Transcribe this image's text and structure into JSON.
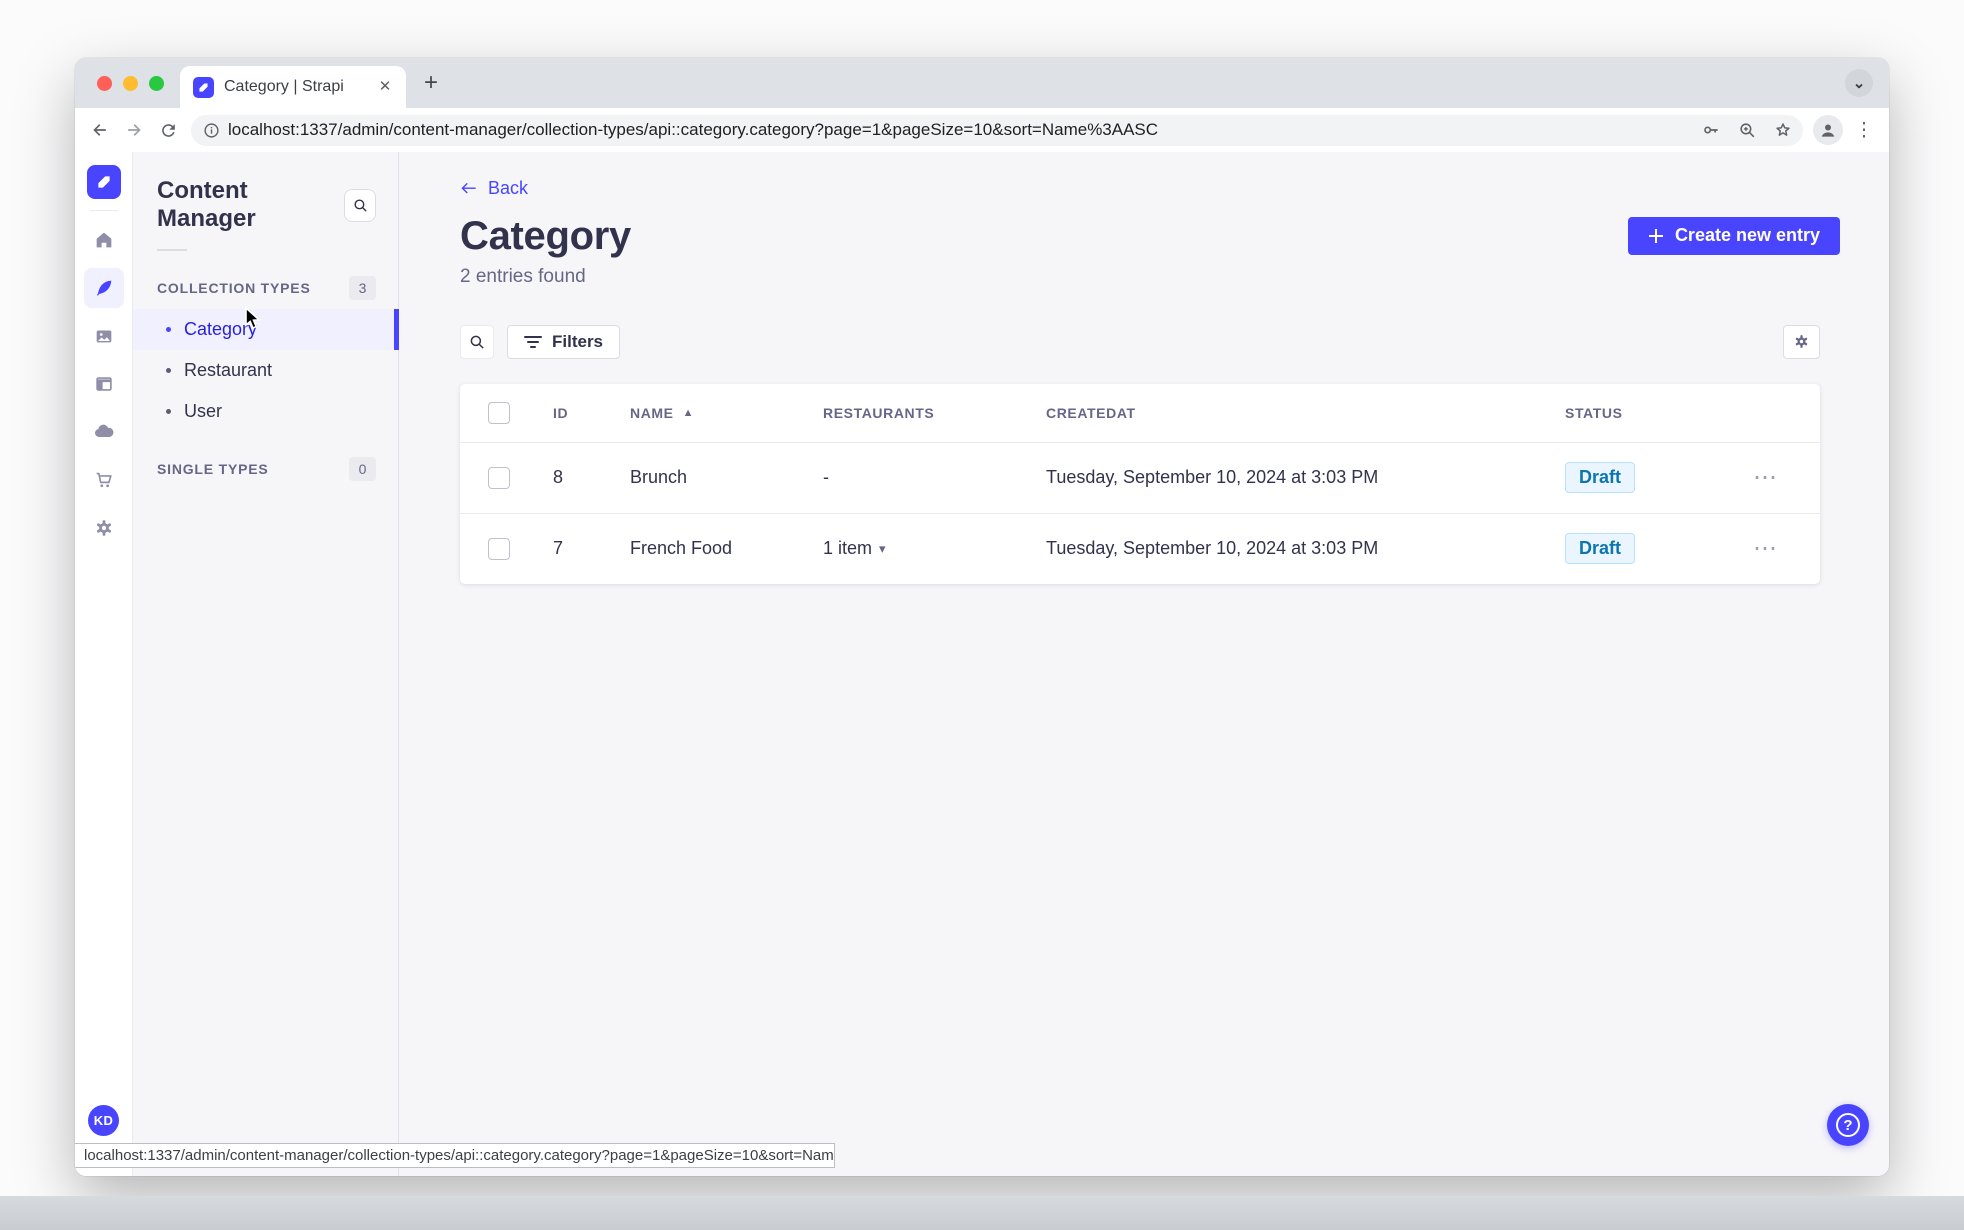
{
  "browser": {
    "tab_title": "Category | Strapi",
    "url": "localhost:1337/admin/content-manager/collection-types/api::category.category?page=1&pageSize=10&sort=Name%3AASC",
    "status_url": "localhost:1337/admin/content-manager/collection-types/api::category.category?page=1&pageSize=10&sort=Name%3AASC"
  },
  "nav_rail": {
    "user_initials": "KD"
  },
  "subnav": {
    "title": "Content Manager",
    "collection_types": {
      "label": "COLLECTION TYPES",
      "count": "3"
    },
    "single_types": {
      "label": "SINGLE TYPES",
      "count": "0"
    },
    "items": [
      {
        "label": "Category",
        "active": true
      },
      {
        "label": "Restaurant",
        "active": false
      },
      {
        "label": "User",
        "active": false
      }
    ]
  },
  "main": {
    "back_label": "Back",
    "title": "Category",
    "subtitle": "2 entries found",
    "create_button_label": "Create new entry",
    "filters_button_label": "Filters",
    "table": {
      "headers": {
        "id": "ID",
        "name": "NAME",
        "restaurants": "RESTAURANTS",
        "createdat": "CREATEDAT",
        "status": "STATUS"
      },
      "rows": [
        {
          "id": "8",
          "name": "Brunch",
          "restaurants": "-",
          "createdat": "Tuesday, September 10, 2024 at 3:03 PM",
          "status": "Draft"
        },
        {
          "id": "7",
          "name": "French Food",
          "restaurants": "1 item",
          "createdat": "Tuesday, September 10, 2024 at 3:03 PM",
          "status": "Draft"
        }
      ]
    }
  },
  "icons": {
    "close": "✕",
    "new_tab": "+",
    "chevron_down": "⌄",
    "overflow": "⋮",
    "sort_asc": "▲",
    "caret_down": "▾",
    "more": "⋯",
    "help": "?"
  },
  "colors": {
    "accent": "#4945ff",
    "active_item_bg": "#f0f0ff",
    "draft_bg": "#eaf5ff",
    "draft_border": "#b8e1ff",
    "draft_text": "#0c75af"
  }
}
